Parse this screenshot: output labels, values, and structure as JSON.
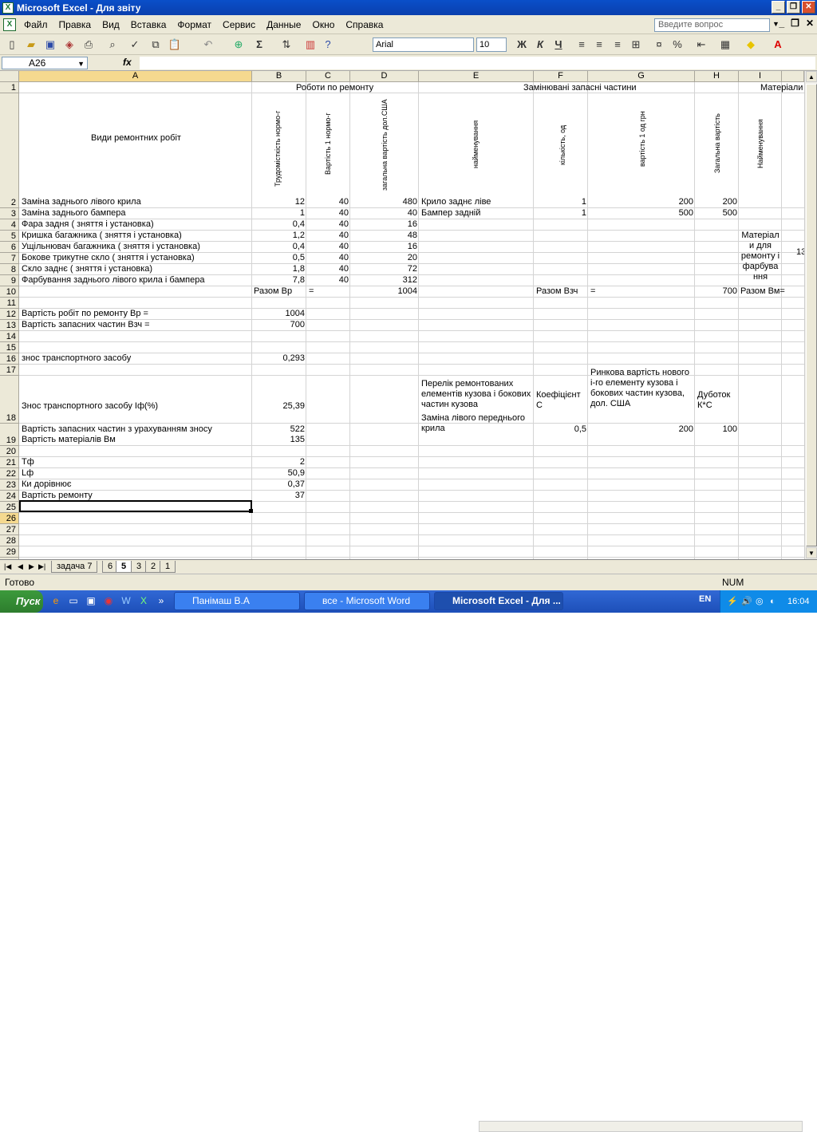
{
  "window": {
    "title": "Microsoft Excel - Для звіту",
    "app_badge": "X"
  },
  "menu": [
    "Файл",
    "Правка",
    "Вид",
    "Вставка",
    "Формат",
    "Сервис",
    "Данные",
    "Окно",
    "Справка"
  ],
  "ask_placeholder": "Введите вопрос",
  "toolbar": {
    "font": "Arial",
    "size": "10",
    "bold": "Ж",
    "italic": "К",
    "underline": "Ч",
    "percent": "%"
  },
  "namebox": "A26",
  "fx": "fx",
  "columns": [
    "A",
    "B",
    "C",
    "D",
    "E",
    "F",
    "G",
    "H",
    "I"
  ],
  "rows": [
    "1",
    "2",
    "3",
    "4",
    "5",
    "6",
    "7",
    "8",
    "9",
    "10",
    "11",
    "12",
    "13",
    "14",
    "15",
    "16",
    "17",
    "18",
    "19",
    "20",
    "21",
    "22",
    "23",
    "24",
    "25",
    "26",
    "27",
    "28",
    "29",
    "30"
  ],
  "headers": {
    "works": "Роботи по ремонту",
    "parts": "Замінювані запасні частини",
    "materials": "Матеріали",
    "a2": "Види ремонтних робіт",
    "b2": "Трудомісткість нормо-г",
    "c2": "Вартість 1 нормо-г",
    "d2": "загальна вартість дол.США",
    "e2": "найменування",
    "f2": "кількість, од",
    "g2": "вартість 1 од грн",
    "h2": "Загальна вартість",
    "i2": "Найменування"
  },
  "works": [
    {
      "name": "Заміна заднього лівого крила",
      "b": "12",
      "c": "40",
      "d": "480"
    },
    {
      "name": "Заміна заднього бампера",
      "b": "1",
      "c": "40",
      "d": "40"
    },
    {
      "name": "Фара задня ( зняття і установка)",
      "b": "0,4",
      "c": "40",
      "d": "16"
    },
    {
      "name": "Кришка багажника ( зняття і установка)",
      "b": "1,2",
      "c": "40",
      "d": "48"
    },
    {
      "name": "Ущільнювач багажника ( зняття і установка)",
      "b": "0,4",
      "c": "40",
      "d": "16"
    },
    {
      "name": "Бокове трикутне скло  ( зняття і установка)",
      "b": "0,5",
      "c": "40",
      "d": "20"
    },
    {
      "name": "Скло заднє  ( зняття і установка)",
      "b": "1,8",
      "c": "40",
      "d": "72"
    },
    {
      "name": "Фарбування заднього лівого крила і бампера",
      "b": "7,8",
      "c": "40",
      "d": "312"
    }
  ],
  "parts": [
    {
      "name": "Крило заднє ліве",
      "qty": "1",
      "price": "200",
      "total": "200"
    },
    {
      "name": "Бампер задній",
      "qty": "1",
      "price": "500",
      "total": "500"
    }
  ],
  "materials_text": "Матеріал и для ремонту і фарбува ння",
  "materials_value": "13",
  "row11": {
    "b": "Разом Вр",
    "c": "=",
    "d": "1004",
    "f": "Разом Взч",
    "g": "=",
    "h": "700",
    "i": "Разом Вм="
  },
  "row13": {
    "a": "Вартість робіт по ремонту Вр =",
    "b": "1004"
  },
  "row14": {
    "a": "Вартість запасних частин Взч =",
    "b": "700"
  },
  "row17": {
    "a": "знос транспортного засобу",
    "b": "0,293"
  },
  "row18": {
    "a": "Знос транспортного засобу Іф(%)",
    "b": "25,39",
    "e": "Перелік ремонтованих елементів кузова і бокових частин кузова",
    "f": "Коефіцієнт С",
    "g": "Ринкова вартість нового і-го елементу кузова і бокових частин кузова, дол. США",
    "h": "Дуботок К*С"
  },
  "row19": {
    "a": "Вартість запасних частин з урахуванням зносу",
    "b": "522",
    "e": "Заміна лівого переднього крила",
    "f": "0,5",
    "g": "200",
    "h": "100"
  },
  "row20": {
    "a": "Вартість матеріалів Вм",
    "b": "135"
  },
  "row22": {
    "a": "Тф",
    "b": "2"
  },
  "row23": {
    "a": "Lф",
    "b": "50,9"
  },
  "row24": {
    "a": "Ки дорівнює",
    "b": "0,37"
  },
  "row25": {
    "a": "Вартість ремонту",
    "b": "37"
  },
  "tabs": [
    "задача 7",
    "6",
    "5",
    "3",
    "2",
    "1"
  ],
  "active_tab": "5",
  "status": {
    "ready": "Готово",
    "num": "NUM"
  },
  "taskbar": {
    "start": "Пуск",
    "tasks": [
      "Панімаш В.А",
      "все - Microsoft Word",
      "Microsoft Excel - Для ..."
    ],
    "lang": "EN",
    "time": "16:04"
  }
}
